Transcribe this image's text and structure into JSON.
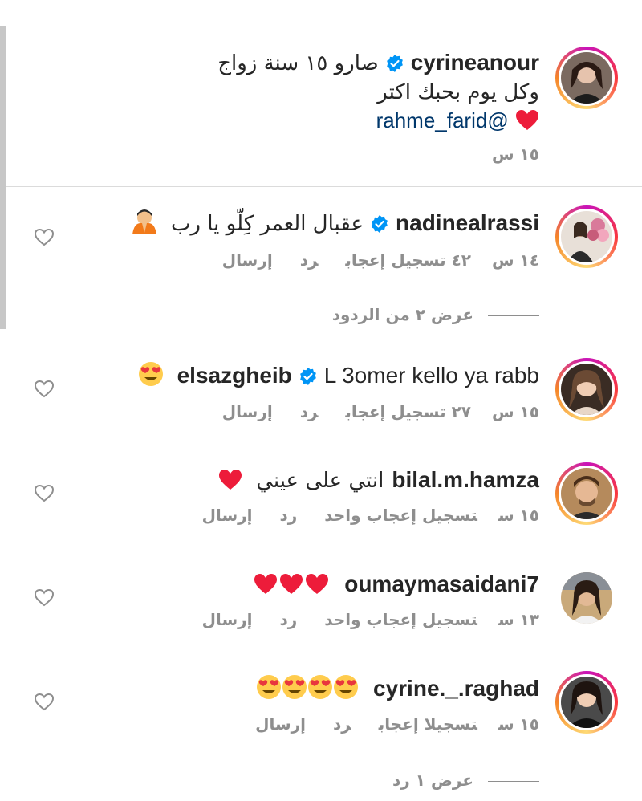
{
  "caption": {
    "username": "cyrineanour",
    "line1": "صارو ١٥ سنة زواج",
    "line2": "وكل يوم بحبك اكتر",
    "mention": "@rahme_farid",
    "time": "١٥ س"
  },
  "comments": [
    {
      "username": "nadinealrassi",
      "text": "عقبال العمر كِلّو يا رب",
      "time": "١٤ س",
      "likes": "٤٢ تسجيل إعجاب",
      "reply": "رد",
      "send": "إرسال",
      "view_replies": "عرض ٢ من الردود"
    },
    {
      "username": "elsazgheib",
      "text": "L 3omer kello ya rabb",
      "time": "١٥ س",
      "likes": "٢٧ تسجيل إعجاب",
      "reply": "رد",
      "send": "إرسال"
    },
    {
      "username": "bilal.m.hamza",
      "text": "انتي على عيني",
      "time": "١٥ س",
      "likes": "تسجيل إعجاب واحد",
      "reply": "رد",
      "send": "إرسال"
    },
    {
      "username": "oumaymasaidani7",
      "text": "",
      "time": "١٣ س",
      "likes": "تسجيل إعجاب واحد",
      "reply": "رد",
      "send": "إرسال"
    },
    {
      "username": "cyrine._.raghad",
      "text": "",
      "time": "١٥ س",
      "likes": "تسجيلا إعجاب",
      "reply": "رد",
      "send": "إرسال",
      "view_replies": "عرض ١ رد"
    }
  ],
  "colors": {
    "verified": "#0095f6",
    "mention": "#00376b",
    "meta": "#8e8e8e",
    "heart_red": "#ed1c3a"
  }
}
